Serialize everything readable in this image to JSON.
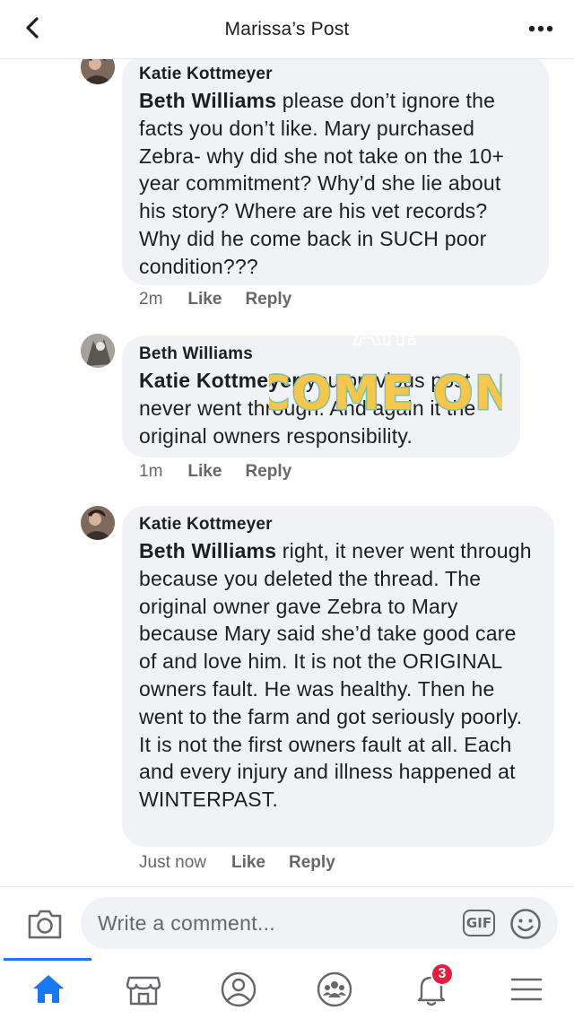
{
  "header": {
    "title": "Marissa’s Post",
    "back_icon": "chevron-left-icon",
    "more_icon": "more-horizontal-icon"
  },
  "comments": [
    {
      "author": "Katie Kottmeyer",
      "mention": "Beth Williams",
      "body": " please don’t ignore the facts you don’t like. Mary purchased Zebra- why did she not take on the 10+ year commitment? Why’d she lie about his story? Where are his vet records? Why did he come back in SUCH poor condition???",
      "time": "2m",
      "like": "Like",
      "reply": "Reply"
    },
    {
      "author": "Beth Williams",
      "mention": "Katie Kottmeyer",
      "body": " you previous post never went through. And again it the original owners responsibility.",
      "time": "1m",
      "like": "Like",
      "reply": "Reply"
    },
    {
      "author": "Katie Kottmeyer",
      "mention": "Beth Williams",
      "body": " right, it never went through because you deleted the thread. The original owner gave Zebra to Mary because Mary said she’d take good care of and love him. It is not the ORIGINAL owners fault. He was healthy. Then he went to the farm and got seriously poorly. It is not the first owners fault at all. Each and every injury and illness happened at WINTERPAST.",
      "time": "Just now",
      "like": "Like",
      "reply": "Reply"
    }
  ],
  "sticker": {
    "line1": "Ah!",
    "line2": "COME ON"
  },
  "composer": {
    "placeholder": "Write a comment...",
    "gif_label": "GIF",
    "camera_icon": "camera-icon",
    "emoji_icon": "smiley-icon"
  },
  "tabbar": {
    "active": "home",
    "notifications_badge": "3",
    "items": [
      "home-icon",
      "marketplace-icon",
      "profile-icon",
      "groups-icon",
      "notifications-icon",
      "menu-icon"
    ]
  },
  "colors": {
    "accent": "#1877f2",
    "bubble": "#f0f2f5",
    "badge": "#e41e3f"
  }
}
